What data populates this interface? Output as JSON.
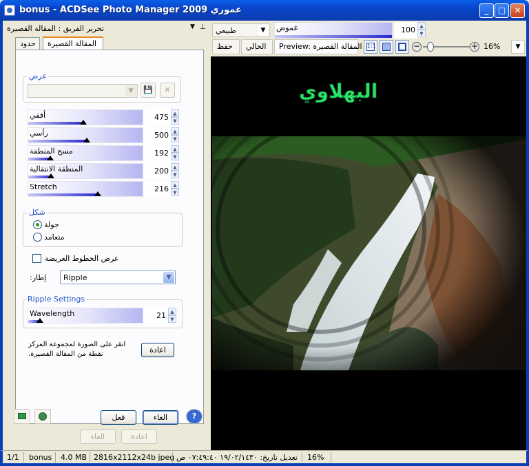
{
  "window": {
    "title": "bonus - ACDSee Photo Manager 2009 عموري",
    "minimize": "_",
    "maximize": "□",
    "close": "✕"
  },
  "panel": {
    "title": "تحرير الفريق : المقالة القصيرة",
    "pin_glyph": "▼",
    "pin2_glyph": "⊥",
    "tabs": [
      {
        "label": "المقالة القصيرة",
        "active": true
      },
      {
        "label": "حدود",
        "active": false
      }
    ],
    "display_group": {
      "legend": "عرض",
      "preset_value": "",
      "save_glyph": "💾",
      "delete_glyph": "✕"
    },
    "sliders": [
      {
        "label": "أفقي",
        "value": 475,
        "fraction": 0.48
      },
      {
        "label": "رأسي",
        "value": 500,
        "fraction": 0.51
      },
      {
        "label": "مسح المنطقة",
        "value": 192,
        "fraction": 0.19
      },
      {
        "label": "المنطقة الانتقالية",
        "value": 200,
        "fraction": 0.2
      },
      {
        "label": "Stretch",
        "value": 216,
        "fraction": 0.61
      }
    ],
    "shape_group": {
      "legend": "شكل",
      "options": [
        {
          "label": "جولة",
          "selected": true
        },
        {
          "label": "متعامد",
          "selected": false
        }
      ]
    },
    "bold_lines_checkbox": {
      "label": "عرض الخطوط العريضة",
      "checked": false
    },
    "frame": {
      "label": ":إطار",
      "value": "Ripple"
    },
    "ripple_group": {
      "legend": "Ripple Settings",
      "wavelength_label": "Wavelength",
      "wavelength_value": 21,
      "wavelength_fraction": 0.1
    },
    "hint_text_1": "انقر على الصورة لمجموعة المركز",
    "hint_text_2": ".نقطة من المقالة القصيرة",
    "reset_center_button": "اعادة",
    "buttons": {
      "apply": "فعل",
      "cancel": "الغاء",
      "help": "?",
      "undo": "الغاء",
      "redo": "اعادة"
    }
  },
  "toolbar": {
    "blend_mode": "طبيعي",
    "opacity_label": "غموض",
    "opacity_value": 100,
    "opacity_fraction": 1.0,
    "save_button": "حفظ",
    "current_button": "الحالي",
    "preview_label": "Preview: المقالة القصيرة",
    "zoom_minus": "−",
    "zoom_plus": "+",
    "zoom_fraction": 0.16,
    "zoom_value": "16%"
  },
  "image": {
    "watermark_text": "البهلاوي"
  },
  "statusbar": {
    "index": "1/1",
    "filename": "bonus",
    "filesize": "4.0 MB",
    "dimensions": "2816x2112x24b jpeg",
    "modified": "تعديل تاريخ: ١٩/٠٢/١٤٣٠ ٠٧:٤٩:٤٠ ص",
    "zoom": "16%"
  }
}
